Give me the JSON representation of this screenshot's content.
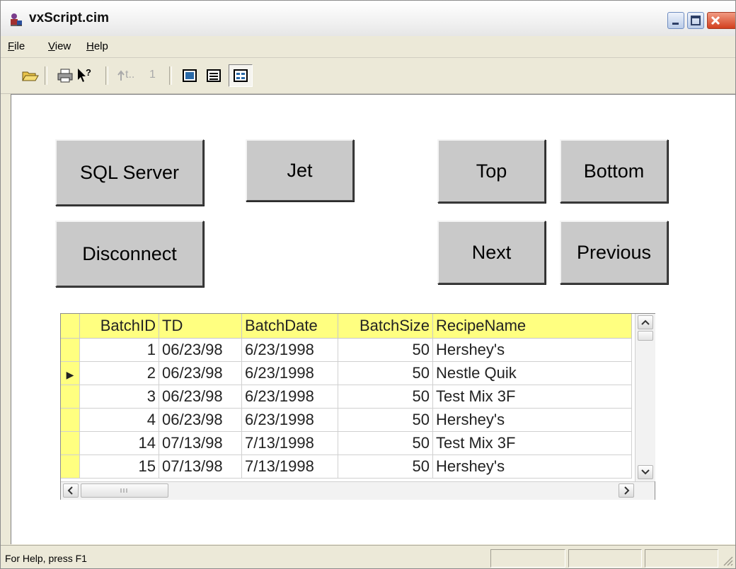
{
  "window": {
    "title": "vxScript.cim",
    "app_icon": "sheriff-app-icon"
  },
  "menu": [
    {
      "label": "File",
      "hotkey": "F",
      "rest": "ile"
    },
    {
      "label": "View",
      "hotkey": "V",
      "rest": "iew"
    },
    {
      "label": "Help",
      "hotkey": "H",
      "rest": "elp"
    }
  ],
  "toolbar": {
    "icons": [
      "open-folder-icon",
      "print-icon",
      "context-help-icon",
      "record-up-icon",
      "record-1-icon",
      "view-single-icon",
      "view-list-icon",
      "view-form-icon"
    ],
    "disabled_text_1": "t..",
    "disabled_text_2": "1"
  },
  "buttons": {
    "sql_server": "SQL Server",
    "jet": "Jet",
    "top": "Top",
    "bottom": "Bottom",
    "disconnect": "Disconnect",
    "next": "Next",
    "previous": "Previous"
  },
  "grid": {
    "columns": [
      "BatchID",
      "TD",
      "BatchDate",
      "BatchSize",
      "RecipeName"
    ],
    "current_row_marker": "▶",
    "rows": [
      {
        "batch_id": "1",
        "td": "06/23/98",
        "batch_date": "6/23/1998",
        "batch_size": "50",
        "recipe": "Hershey's",
        "current": false
      },
      {
        "batch_id": "2",
        "td": "06/23/98",
        "batch_date": "6/23/1998",
        "batch_size": "50",
        "recipe": "Nestle Quik",
        "current": true
      },
      {
        "batch_id": "3",
        "td": "06/23/98",
        "batch_date": "6/23/1998",
        "batch_size": "50",
        "recipe": "Test Mix 3F",
        "current": false
      },
      {
        "batch_id": "4",
        "td": "06/23/98",
        "batch_date": "6/23/1998",
        "batch_size": "50",
        "recipe": "Hershey's",
        "current": false
      },
      {
        "batch_id": "14",
        "td": "07/13/98",
        "batch_date": "7/13/1998",
        "batch_size": "50",
        "recipe": "Test Mix 3F",
        "current": false
      },
      {
        "batch_id": "15",
        "td": "07/13/98",
        "batch_date": "7/13/1998",
        "batch_size": "50",
        "recipe": "Hershey's",
        "current": false
      }
    ],
    "header_color": "#ffff80"
  },
  "statusbar": {
    "text": "For Help, press F1"
  },
  "colors": {
    "button_face": "#c9c9c9",
    "grid_header": "#ffff80",
    "close_button": "#d2401f"
  }
}
